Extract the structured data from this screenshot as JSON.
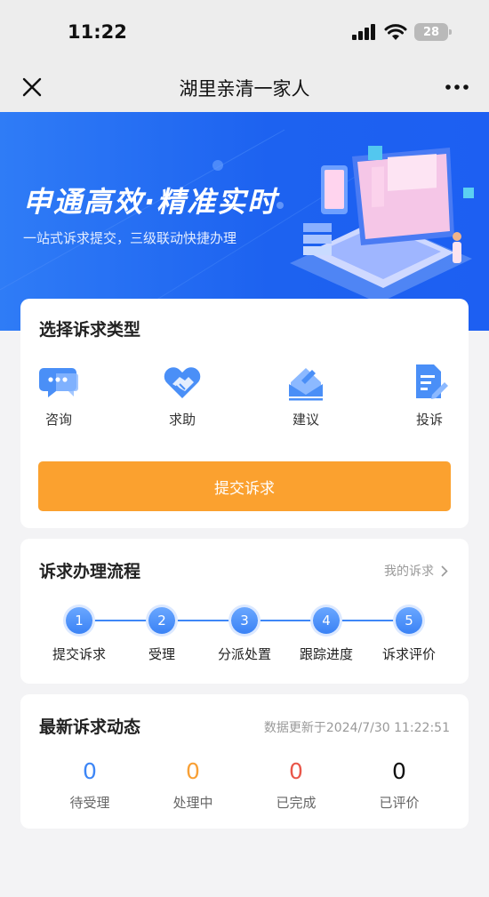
{
  "status_bar": {
    "time": "11:22",
    "battery": "28"
  },
  "nav": {
    "title": "湖里亲清一家人",
    "close_icon": "close-icon",
    "more_icon": "more-icon"
  },
  "banner": {
    "title": "申通高效·精准实时",
    "subtitle": "一站式诉求提交，三级联动快捷办理"
  },
  "type_card": {
    "heading": "选择诉求类型",
    "items": [
      {
        "label": "咨询",
        "icon": "chat-bubble-icon"
      },
      {
        "label": "求助",
        "icon": "handshake-icon"
      },
      {
        "label": "建议",
        "icon": "envelope-icon"
      },
      {
        "label": "投诉",
        "icon": "document-edit-icon"
      }
    ],
    "submit_label": "提交诉求"
  },
  "flow_card": {
    "heading": "诉求办理流程",
    "my_link": "我的诉求",
    "steps": [
      {
        "num": "1",
        "label": "提交诉求"
      },
      {
        "num": "2",
        "label": "受理"
      },
      {
        "num": "3",
        "label": "分派处置"
      },
      {
        "num": "4",
        "label": "跟踪进度"
      },
      {
        "num": "5",
        "label": "诉求评价"
      }
    ]
  },
  "stats_card": {
    "heading": "最新诉求动态",
    "updated": "数据更新于2024/7/30 11:22:51",
    "items": [
      {
        "value": "0",
        "label": "待受理",
        "color": "#3d86f6"
      },
      {
        "value": "0",
        "label": "处理中",
        "color": "#f8a036"
      },
      {
        "value": "0",
        "label": "已完成",
        "color": "#e9574a"
      },
      {
        "value": "0",
        "label": "已评价",
        "color": "#111111"
      }
    ]
  },
  "colors": {
    "accent": "#3d86f6",
    "submit": "#fba12f",
    "banner": "#1d62f0"
  }
}
